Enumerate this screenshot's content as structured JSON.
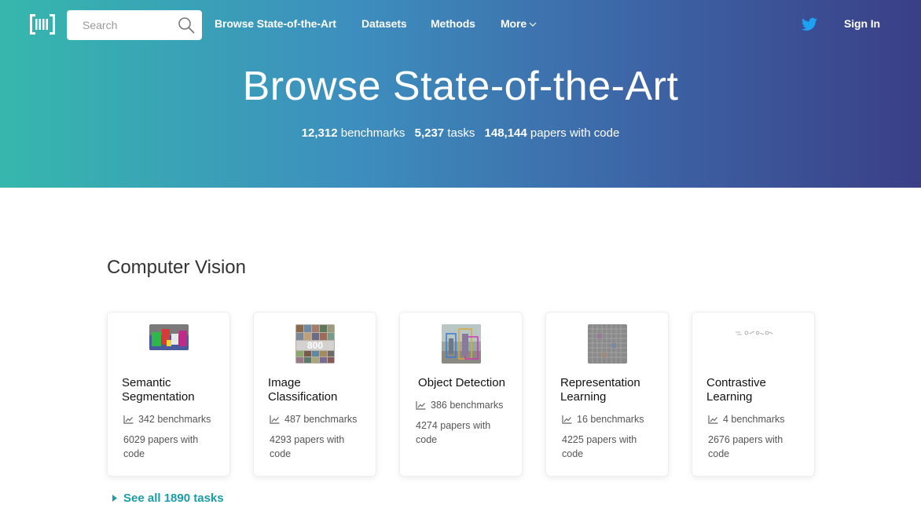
{
  "header": {
    "search_placeholder": "Search",
    "nav": {
      "browse": "Browse State-of-the-Art",
      "datasets": "Datasets",
      "methods": "Methods",
      "more": "More",
      "sign_in": "Sign In"
    }
  },
  "hero": {
    "title": "Browse State-of-the-Art",
    "stats": {
      "benchmarks_count": "12,312",
      "benchmarks_label": "benchmarks",
      "tasks_count": "5,237",
      "tasks_label": "tasks",
      "papers_count": "148,144",
      "papers_label": "papers with code"
    }
  },
  "section": {
    "title": "Computer Vision",
    "cards": [
      {
        "title": "Semantic Segmentation",
        "benchmarks": "342 benchmarks",
        "papers": "6029 papers with code"
      },
      {
        "title": "Image Classification",
        "benchmarks": "487 benchmarks",
        "papers": "4293 papers with code"
      },
      {
        "title": "Object Detection",
        "benchmarks": "386 benchmarks",
        "papers": "4274 papers with code"
      },
      {
        "title": "Representation Learning",
        "benchmarks": "16 benchmarks",
        "papers": "4225 papers with code"
      },
      {
        "title": "Contrastive Learning",
        "benchmarks": "4 benchmarks",
        "papers": "2676 papers with code"
      }
    ],
    "see_all": "See all 1890 tasks"
  },
  "colors": {
    "gradient_start": "#36b7ad",
    "gradient_end": "#3a3f86",
    "link_accent": "#1b9da6",
    "twitter_blue": "#1da1f2"
  },
  "icons": [
    "logo-icon",
    "search-icon",
    "chevron-down-icon",
    "twitter-icon",
    "chart-line-icon",
    "caret-right-icon"
  ]
}
